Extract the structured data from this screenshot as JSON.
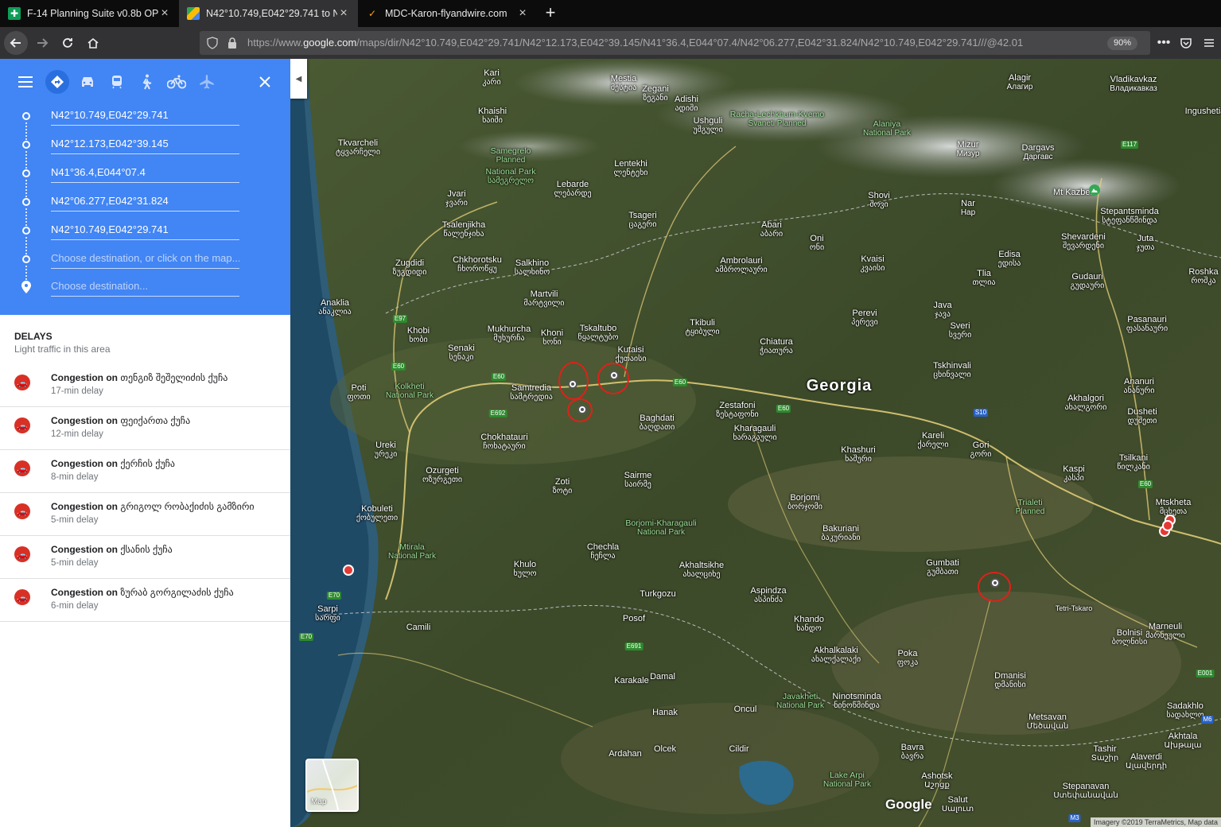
{
  "tabs": [
    {
      "title": "F-14 Planning Suite v0.8b OPEN",
      "active": false
    },
    {
      "title": "N42°10.749,E042°29.741 to N42",
      "active": true
    },
    {
      "title": "MDC-Karon-flyandwire.com",
      "active": false
    }
  ],
  "url": {
    "prefix": "https://www.",
    "domain": "google.com",
    "path": "/maps/dir/N42°10.749,E042°29.741/N42°12.173,E042°39.145/N41°36.4,E044°07.4/N42°06.277,E042°31.824/N42°10.749,E042°29.741///@42.01"
  },
  "zoom": "90%",
  "waypoints": [
    "N42°10.749,E042°29.741",
    "N42°12.173,E042°39.145",
    "N41°36.4,E044°07.4",
    "N42°06.277,E042°31.824",
    "N42°10.749,E042°29.741"
  ],
  "destination_placeholders": [
    "Choose destination, or click on the map...",
    "Choose destination..."
  ],
  "delays": {
    "heading": "DELAYS",
    "subheading": "Light traffic in this area",
    "items": [
      {
        "pre": "Congestion on",
        "road": "თენგიზ შეშელიძის ქუჩა",
        "delay": "17-min delay"
      },
      {
        "pre": "Congestion on",
        "road": "ფეიქართა ქუჩა",
        "delay": "12-min delay"
      },
      {
        "pre": "Congestion on",
        "road": "ქერჩის ქუჩა",
        "delay": "8-min delay"
      },
      {
        "pre": "Congestion on",
        "road": "გრიგოლ რობაქიძის გამზირი",
        "delay": "5-min delay"
      },
      {
        "pre": "Congestion on",
        "road": "ქსანის ქუჩა",
        "delay": "5-min delay"
      },
      {
        "pre": "Congestion on",
        "road": "ზურაბ გორგილაძის ქუჩა",
        "delay": "6-min delay"
      }
    ]
  },
  "map": {
    "country_label": "Georgia",
    "layer_label": "Map",
    "logo": "Google",
    "attribution": "Imagery ©2019 TerraMetrics, Map data",
    "places": [
      {
        "name": "Kari",
        "sub": "კარი"
      },
      {
        "name": "Mestia",
        "sub": "მესტია"
      },
      {
        "name": "Zegani",
        "sub": "ზეგანი"
      },
      {
        "name": "Adishi",
        "sub": "ადიში"
      },
      {
        "name": "Ushguli",
        "sub": "უშგული"
      },
      {
        "name": "Khaishi",
        "sub": "ხაიში"
      },
      {
        "name": "Tkvarcheli",
        "sub": "ტყვარჩელი"
      },
      {
        "name": "Samegrelo",
        "sub": "Planned"
      },
      {
        "name": "National Park",
        "sub": "სამეგრელო"
      },
      {
        "name": "Lentekhi",
        "sub": "ლენტეხი"
      },
      {
        "name": "Lebarde",
        "sub": "ლებარდე"
      },
      {
        "name": "Jvari",
        "sub": "ჯვარი"
      },
      {
        "name": "Tsalenjikha",
        "sub": "წალენჯიხა"
      },
      {
        "name": "Tsageri",
        "sub": "ცაგერი"
      },
      {
        "name": "Zugdidi",
        "sub": "ზუგდიდი"
      },
      {
        "name": "Chkhorotsku",
        "sub": "ჩხოროწყუ"
      },
      {
        "name": "Salkhino",
        "sub": "სალხინო"
      },
      {
        "name": "Martvili",
        "sub": "მარტვილი"
      },
      {
        "name": "Anaklia",
        "sub": "ანაკლია"
      },
      {
        "name": "Khobi",
        "sub": "ხობი"
      },
      {
        "name": "Mukhurcha",
        "sub": "მუხურჩა"
      },
      {
        "name": "Khoni",
        "sub": "ხონი"
      },
      {
        "name": "Tskaltubo",
        "sub": "წყალტუბო"
      },
      {
        "name": "Kutaisi",
        "sub": "ქუთაისი"
      },
      {
        "name": "Senaki",
        "sub": "სენაკი"
      },
      {
        "name": "Poti",
        "sub": "ფოთი"
      },
      {
        "name": "Kolkheti",
        "sub": "National Park"
      },
      {
        "name": "Samtredia",
        "sub": "სამტრედია"
      },
      {
        "name": "Baghdati",
        "sub": "ბაღდათი"
      },
      {
        "name": "Zestafoni",
        "sub": "ზესტაფონი"
      },
      {
        "name": "Chokhatauri",
        "sub": "ჩოხატაური"
      },
      {
        "name": "Ureki",
        "sub": "ურეკი"
      },
      {
        "name": "Ozurgeti",
        "sub": "ოზურგეთი"
      },
      {
        "name": "Zoti",
        "sub": "ზოტი"
      },
      {
        "name": "Sairme",
        "sub": "საირმე"
      },
      {
        "name": "Kobuleti",
        "sub": "ქობულეთი"
      },
      {
        "name": "Borjomi-Kharagauli",
        "sub": "National Park"
      },
      {
        "name": "Mtirala",
        "sub": "National Park"
      },
      {
        "name": "Khulo",
        "sub": "ხულო"
      },
      {
        "name": "Chechla",
        "sub": "ჩეჩლა"
      },
      {
        "name": "Akhaltsikhe",
        "sub": "ახალციხე"
      },
      {
        "name": "Sarpi",
        "sub": "სარფი"
      },
      {
        "name": "Camili",
        "sub": ""
      },
      {
        "name": "Turkgozu",
        "sub": ""
      },
      {
        "name": "Posof",
        "sub": ""
      },
      {
        "name": "Borjomi",
        "sub": "ბორჯომი"
      },
      {
        "name": "Bakuriani",
        "sub": "ბაკურიანი"
      },
      {
        "name": "Aspindza",
        "sub": "ასპინძა"
      },
      {
        "name": "Khando",
        "sub": "ხანდო"
      },
      {
        "name": "Akhalkalaki",
        "sub": "ახალქალაქი"
      },
      {
        "name": "Poka",
        "sub": "ფოკა"
      },
      {
        "name": "Gumbati",
        "sub": "გუმბათი"
      },
      {
        "name": "Javakheti",
        "sub": "National Park"
      },
      {
        "name": "Ninotsminda",
        "sub": "ნინოწმინდა"
      },
      {
        "name": "Dmanisi",
        "sub": "დმანისი"
      },
      {
        "name": "Karakale",
        "sub": ""
      },
      {
        "name": "Damal",
        "sub": ""
      },
      {
        "name": "Hanak",
        "sub": ""
      },
      {
        "name": "Ardahan",
        "sub": ""
      },
      {
        "name": "Cildir",
        "sub": ""
      },
      {
        "name": "Olcek",
        "sub": ""
      },
      {
        "name": "Oncul",
        "sub": ""
      },
      {
        "name": "Lake Arpi",
        "sub": "National Park"
      },
      {
        "name": "Bavra",
        "sub": "ბავრა"
      },
      {
        "name": "Ashotsk",
        "sub": "Աշոցք"
      },
      {
        "name": "Salut",
        "sub": "Սալուտ"
      },
      {
        "name": "Stepanavan",
        "sub": "Ստեփանավան"
      },
      {
        "name": "Tashir",
        "sub": "Տաշիր"
      },
      {
        "name": "Metsavan",
        "sub": "Մեծավան"
      },
      {
        "name": "Alaverdi",
        "sub": "Ալավերդի"
      },
      {
        "name": "Akhtala",
        "sub": "Ախթալա"
      },
      {
        "name": "Sadakhlo",
        "sub": "სადახლო"
      },
      {
        "name": "Bolnisi",
        "sub": "ბოლნისი"
      },
      {
        "name": "Marneuli",
        "sub": "მარნეული"
      },
      {
        "name": "Tetri-Tskaro",
        "sub": ""
      },
      {
        "name": "Trialeti",
        "sub": "Planned"
      },
      {
        "name": "Mtskheta",
        "sub": "მცხეთა"
      },
      {
        "name": "Tsilkani",
        "sub": "წილკანი"
      },
      {
        "name": "Kaspi",
        "sub": "კასპი"
      },
      {
        "name": "Gori",
        "sub": "გორი"
      },
      {
        "name": "Kareli",
        "sub": "ქარელი"
      },
      {
        "name": "Khashuri",
        "sub": "ხაშური"
      },
      {
        "name": "Kharagauli",
        "sub": "ხარაგაული"
      },
      {
        "name": "Tskhinvali",
        "sub": "ცხინვალი"
      },
      {
        "name": "Akhalgori",
        "sub": "ახალგორი"
      },
      {
        "name": "Dusheti",
        "sub": "დუშეთი"
      },
      {
        "name": "Ananuri",
        "sub": "ანანური"
      },
      {
        "name": "Pasanauri",
        "sub": "ფასანაური"
      },
      {
        "name": "Gudauri",
        "sub": "გუდაური"
      },
      {
        "name": "Shevardeni",
        "sub": "შევარდენი"
      },
      {
        "name": "Stepantsminda",
        "sub": "სტეფანწმინდა"
      },
      {
        "name": "Juta",
        "sub": "ჯუთა"
      },
      {
        "name": "Roshka",
        "sub": "როშკა"
      },
      {
        "name": "Mt Kazbek",
        "sub": ""
      },
      {
        "name": "Vladikavkaz",
        "sub": "Владикавказ"
      },
      {
        "name": "Alagir",
        "sub": "Алагир"
      },
      {
        "name": "Alaniya",
        "sub": "National Park"
      },
      {
        "name": "Mizur",
        "sub": "Мизур"
      },
      {
        "name": "Dargavs",
        "sub": "Даргавс"
      },
      {
        "name": "Shovi",
        "sub": "შოვი"
      },
      {
        "name": "Nar",
        "sub": "Hap"
      },
      {
        "name": "Abari",
        "sub": "აბარი"
      },
      {
        "name": "Oni",
        "sub": "ონი"
      },
      {
        "name": "Ambrolauri",
        "sub": "ამბროლაური"
      },
      {
        "name": "Kvaisi",
        "sub": "კვაისი"
      },
      {
        "name": "Tlia",
        "sub": "თლია"
      },
      {
        "name": "Edisa",
        "sub": "ედისა"
      },
      {
        "name": "Java",
        "sub": "ჯავა"
      },
      {
        "name": "Sveri",
        "sub": "სვერი"
      },
      {
        "name": "Perevi",
        "sub": "პერევი"
      },
      {
        "name": "Tkibuli",
        "sub": "ტყიბული"
      },
      {
        "name": "Chiatura",
        "sub": "ჭიათურა"
      },
      {
        "name": "Racha-Lechkhum-Kvemo",
        "sub": "Svaneti Planned"
      },
      {
        "name": "Ingushetia",
        "sub": ""
      },
      {
        "name": "Bolnisi",
        "sub": "ბოლნისი"
      }
    ],
    "highway_shields": [
      "E97",
      "E60",
      "E60",
      "E60",
      "E60",
      "E692",
      "E117",
      "S10",
      "E60",
      "E70",
      "E70",
      "E691",
      "E001",
      "M6",
      "M3"
    ]
  }
}
